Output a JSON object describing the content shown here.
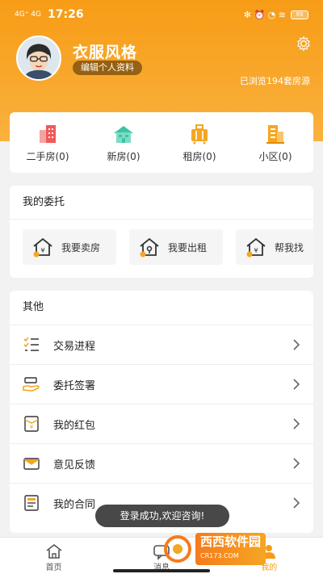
{
  "status": {
    "signal": "4G⁺ 4G",
    "time": "17:26",
    "icons": "✻ ⏰ ◔ ≋",
    "battery": "99"
  },
  "profile": {
    "name": "衣服风格",
    "edit_label": "编辑个人资料",
    "viewed_text": "已浏览194套房源"
  },
  "quick": [
    {
      "label": "二手房(0)",
      "icon": "building-icon",
      "color": "#f05a5a"
    },
    {
      "label": "新房(0)",
      "icon": "house-icon",
      "color": "#3cc4a4"
    },
    {
      "label": "租房(0)",
      "icon": "suitcase-icon",
      "color": "#f5a623"
    },
    {
      "label": "小区(0)",
      "icon": "community-icon",
      "color": "#f5a623"
    }
  ],
  "entrust": {
    "title": "我的委托",
    "items": [
      {
        "label": "我要卖房"
      },
      {
        "label": "我要出租"
      },
      {
        "label": "帮我找"
      }
    ]
  },
  "other": {
    "title": "其他",
    "rows": [
      {
        "label": "交易进程",
        "icon": "checklist-icon"
      },
      {
        "label": "委托签署",
        "icon": "handshake-icon"
      },
      {
        "label": "我的红包",
        "icon": "red-packet-icon"
      },
      {
        "label": "意见反馈",
        "icon": "mail-icon"
      },
      {
        "label": "我的合同",
        "icon": "contract-icon"
      }
    ]
  },
  "toast": "登录成功,欢迎咨询!",
  "tabs": [
    {
      "label": "首页",
      "icon": "home-icon"
    },
    {
      "label": "消息",
      "icon": "message-icon"
    },
    {
      "label": "我的",
      "icon": "profile-icon"
    }
  ],
  "watermark": {
    "text": "西西软件园",
    "sub": "CR173.COM"
  },
  "colors": {
    "accent": "#f79c16",
    "accent_light": "#fab13e"
  }
}
